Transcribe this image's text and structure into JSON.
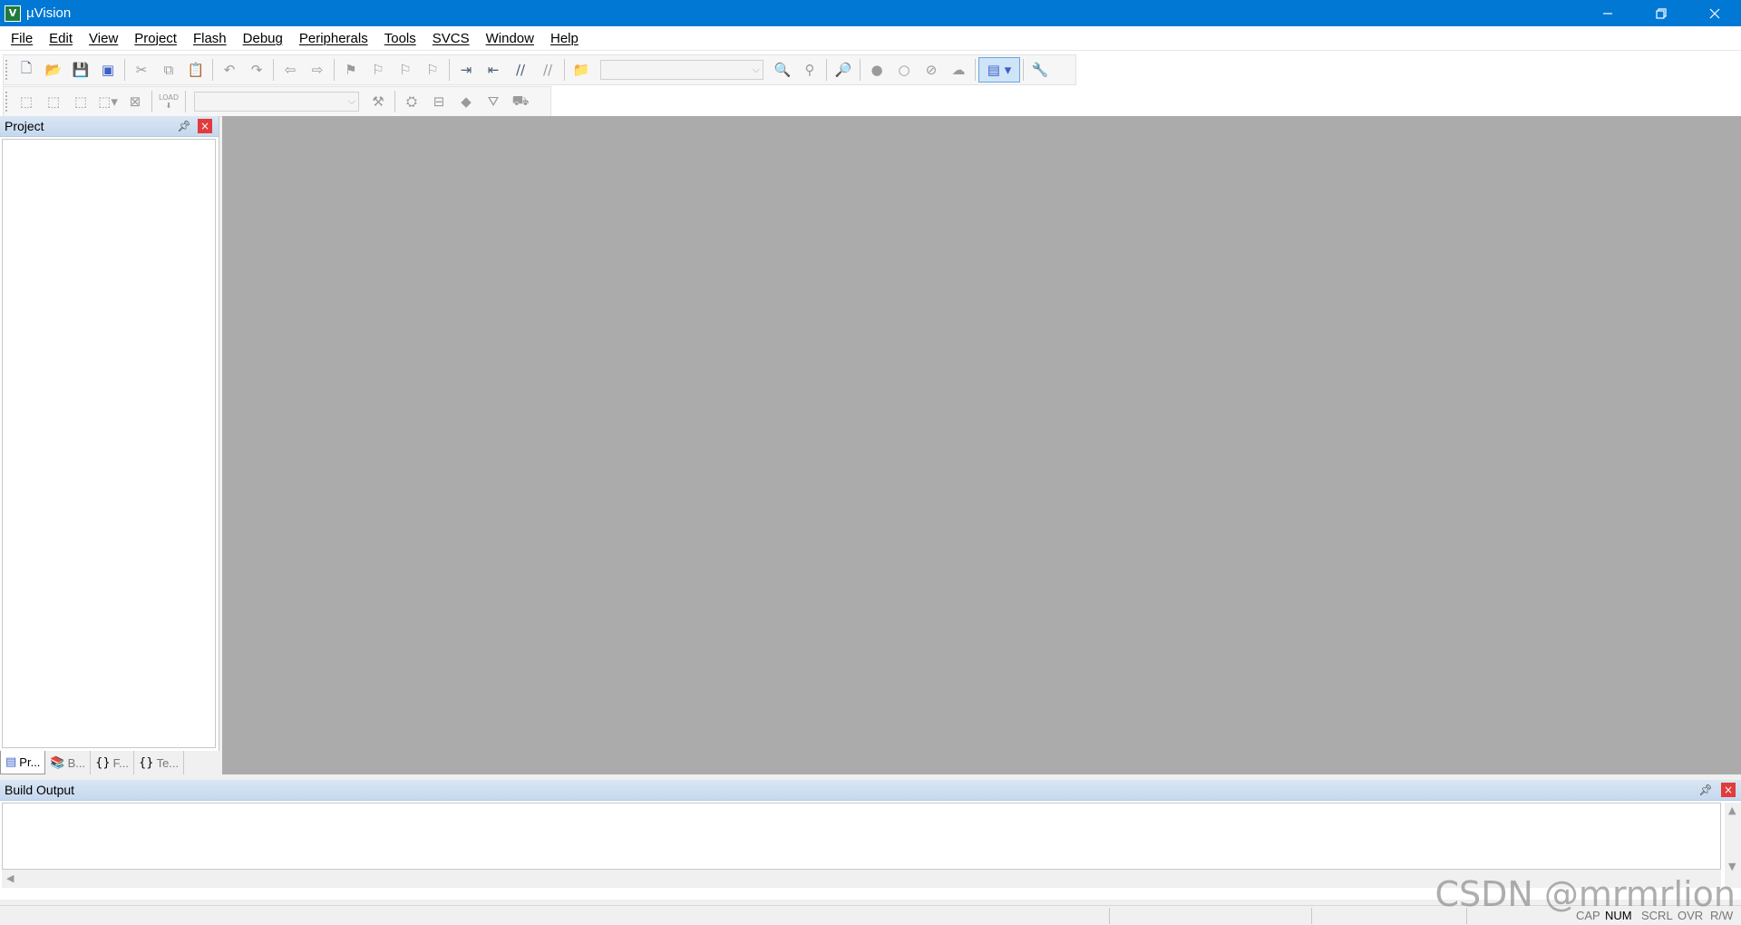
{
  "window": {
    "title": "µVision",
    "app_icon": "V",
    "min_icon": "minimize-icon",
    "max_icon": "restore-icon",
    "close_icon": "close-icon",
    "accent": "#0078d4"
  },
  "menu": [
    {
      "label": "File"
    },
    {
      "label": "Edit"
    },
    {
      "label": "View"
    },
    {
      "label": "Project"
    },
    {
      "label": "Flash"
    },
    {
      "label": "Debug"
    },
    {
      "label": "Peripherals"
    },
    {
      "label": "Tools"
    },
    {
      "label": "SVCS"
    },
    {
      "label": "Window"
    },
    {
      "label": "Help"
    }
  ],
  "toolbar1": {
    "icons": [
      "new-file-icon",
      "open-file-icon",
      "save-icon",
      "save-all-icon",
      "cut-icon",
      "copy-icon",
      "paste-icon",
      "undo-icon",
      "redo-icon",
      "navigate-back-icon",
      "navigate-forward-icon",
      "bookmark-icon",
      "prev-bookmark-icon",
      "next-bookmark-icon",
      "clear-bookmarks-icon",
      "indent-icon",
      "unindent-icon",
      "comment-icon",
      "uncomment-icon",
      "find-in-files-icon",
      "find-combo",
      "find-icon",
      "incremental-find-icon",
      "debug-session-icon",
      "breakpoint-icon",
      "disable-breakpoint-icon",
      "disable-all-breakpoints-icon",
      "kill-all-breakpoints-icon",
      "window-layout-icon",
      "configure-icon"
    ],
    "find_combo_value": ""
  },
  "toolbar2": {
    "icons": [
      "translate-icon",
      "build-icon",
      "rebuild-icon",
      "batch-build-icon",
      "stop-build-icon",
      "download-icon",
      "target-combo",
      "target-options-icon",
      "manage-components-icon",
      "pack-installer-icon",
      "select-device-icon",
      "manage-project-items-icon",
      "manage-rte-icon"
    ],
    "download_label": "LOAD",
    "target_combo_value": ""
  },
  "project_panel": {
    "title": "Project",
    "pin_icon": "pin-icon",
    "close_icon": "close-icon",
    "tabs": [
      {
        "label": "Pr...",
        "icon": "project-tab-icon"
      },
      {
        "label": "B...",
        "icon": "books-tab-icon"
      },
      {
        "label": "F...",
        "icon": "functions-tab-icon"
      },
      {
        "label": "Te...",
        "icon": "templates-tab-icon"
      }
    ]
  },
  "build_output": {
    "title": "Build Output",
    "content": ""
  },
  "statusbar": {
    "indicators": [
      "CAP",
      "NUM",
      "SCRL",
      "OVR",
      "R/W"
    ],
    "active": "NUM"
  },
  "watermark": "CSDN @mrmrlion"
}
